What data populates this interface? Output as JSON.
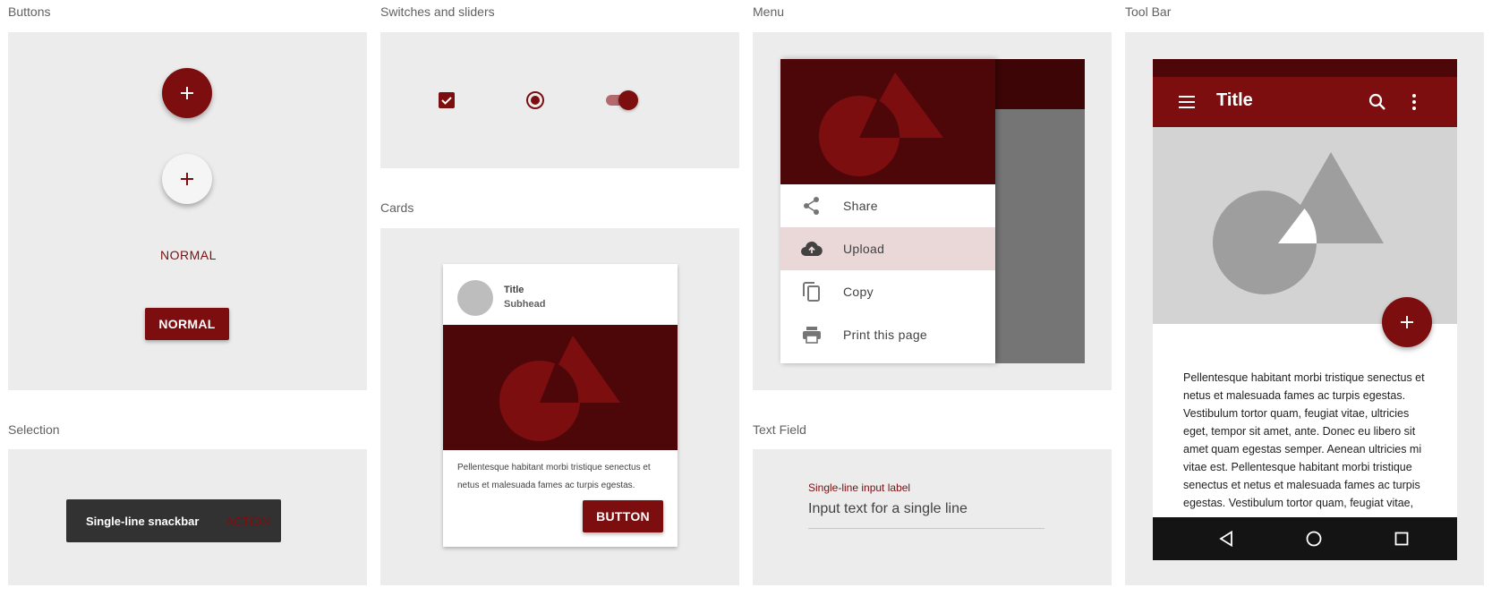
{
  "sections": {
    "buttons": "Buttons",
    "switches": "Switches and sliders",
    "menu": "Menu",
    "toolbar": "Tool Bar",
    "cards": "Cards",
    "selection": "Selection",
    "text_field": "Text Field"
  },
  "buttons": {
    "flat_label": "NORMAL",
    "raised_label": "NORMAL"
  },
  "selection": {
    "snackbar_text": "Single-line snackbar",
    "snackbar_action": "ACTION"
  },
  "card": {
    "title": "Title",
    "subhead": "Subhead",
    "body": "Pellentesque habitant morbi tristique senectus et netus et malesuada fames ac turpis egestas.",
    "button_label": "BUTTON"
  },
  "menu": {
    "items": [
      {
        "label": "Share",
        "icon": "share-icon"
      },
      {
        "label": "Upload",
        "icon": "cloud-upload-icon"
      },
      {
        "label": "Copy",
        "icon": "copy-icon"
      },
      {
        "label": "Print this page",
        "icon": "print-icon"
      }
    ],
    "highlighted_item": "Upload"
  },
  "text_field": {
    "label": "Single-line input label",
    "value": "Input text for a single line"
  },
  "toolbar": {
    "title": "Title",
    "body": "Pellentesque habitant morbi tristique senectus et netus et malesuada fames ac turpis egestas. Vestibulum tortor quam, feugiat vitae, ultricies eget, tempor sit amet, ante. Donec eu libero sit amet quam egestas semper. Aenean ultricies mi vitae est. Pellentesque habitant morbi tristique senectus et netus et malesuada fames ac turpis egestas. Vestibulum tortor quam, feugiat vitae,"
  },
  "colors": {
    "primary": "#7d0e10",
    "primary_dark": "#4e0709",
    "panel": "#ececec",
    "menu_highlight": "#ead8d9"
  },
  "controls": {
    "checkbox_checked": true,
    "radio_selected": true,
    "switch_on": true
  }
}
